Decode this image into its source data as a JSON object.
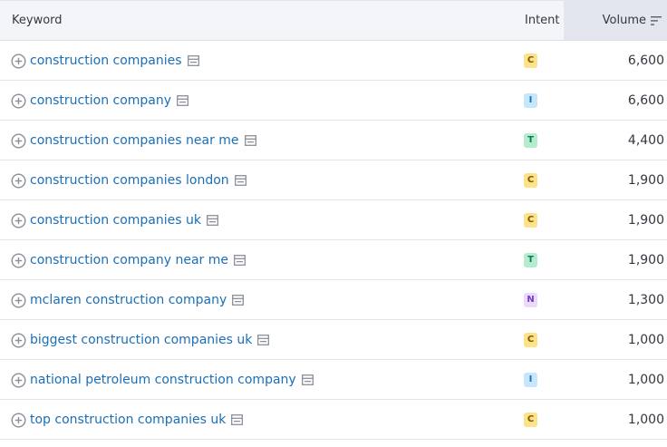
{
  "header": {
    "keyword": "Keyword",
    "intent": "Intent",
    "volume": "Volume"
  },
  "rows": [
    {
      "keyword": "construction companies",
      "intent": "C",
      "intent_class": "c",
      "volume": "6,600"
    },
    {
      "keyword": "construction company",
      "intent": "I",
      "intent_class": "i",
      "volume": "6,600"
    },
    {
      "keyword": "construction companies near me",
      "intent": "T",
      "intent_class": "t",
      "volume": "4,400"
    },
    {
      "keyword": "construction companies london",
      "intent": "C",
      "intent_class": "c",
      "volume": "1,900"
    },
    {
      "keyword": "construction companies uk",
      "intent": "C",
      "intent_class": "c",
      "volume": "1,900"
    },
    {
      "keyword": "construction company near me",
      "intent": "T",
      "intent_class": "t",
      "volume": "1,900"
    },
    {
      "keyword": "mclaren construction company",
      "intent": "N",
      "intent_class": "n",
      "volume": "1,300"
    },
    {
      "keyword": "biggest construction companies uk",
      "intent": "C",
      "intent_class": "c",
      "volume": "1,000"
    },
    {
      "keyword": "national petroleum construction company",
      "intent": "I",
      "intent_class": "i",
      "volume": "1,000"
    },
    {
      "keyword": "top construction companies uk",
      "intent": "C",
      "intent_class": "c",
      "volume": "1,000"
    }
  ],
  "colors": {
    "link": "#1a6fb8",
    "intent_commercial": "#fde28a",
    "intent_informational": "#c6e6fb",
    "intent_transactional": "#b5ecd0",
    "intent_navigational": "#e9dafb"
  },
  "icons": {
    "add": "plus-circle-icon",
    "serp": "serp-features-icon",
    "sort": "sort-descending-icon"
  }
}
